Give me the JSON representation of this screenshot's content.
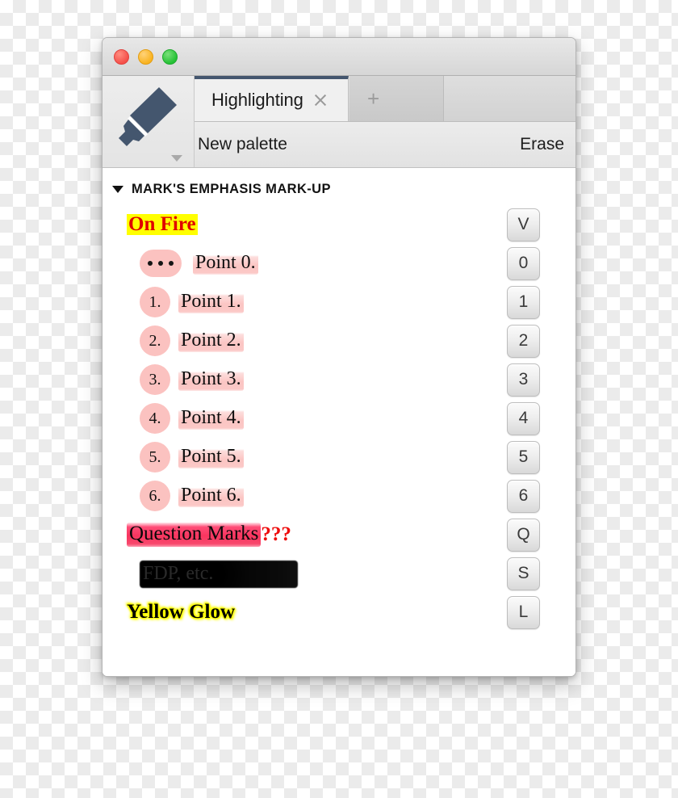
{
  "window": {
    "traffic_lights": [
      "close",
      "minimize",
      "maximize"
    ]
  },
  "tabs": {
    "active": {
      "label": "Highlighting",
      "close_icon": "close-icon"
    },
    "new_tab": {
      "label": "+"
    }
  },
  "tool": {
    "icon": "highlighter-marker-icon",
    "caret": "chevron-down-icon"
  },
  "toolbar": {
    "new_palette_label": "New palette",
    "erase_label": "Erase"
  },
  "section": {
    "disclosure": "disclosure-triangle-open",
    "title": "MARK'S EMPHASIS MARK-UP"
  },
  "colors": {
    "yellow_highlight": "#ffff00",
    "fire_text": "#e00000",
    "pink_highlight": "#fbc2c0",
    "crimson_highlight": "#f8355f",
    "question_mark_red": "#ee0d0d",
    "redact_black": "#000000",
    "tab_accent": "#44566e",
    "marker_body": "#44566e"
  },
  "rows": [
    {
      "style": "onfire",
      "text": "On Fire",
      "key": "V"
    },
    {
      "style": "bullet",
      "text": "Point 0.",
      "key": "0",
      "bullet_dots": 3
    },
    {
      "style": "numbered",
      "text": "Point 1.",
      "key": "1",
      "number": "1."
    },
    {
      "style": "numbered",
      "text": "Point 2.",
      "key": "2",
      "number": "2."
    },
    {
      "style": "numbered",
      "text": "Point 3.",
      "key": "3",
      "number": "3."
    },
    {
      "style": "numbered",
      "text": "Point 4.",
      "key": "4",
      "number": "4."
    },
    {
      "style": "numbered",
      "text": "Point 5.",
      "key": "5",
      "number": "5."
    },
    {
      "style": "numbered",
      "text": "Point 6.",
      "key": "6",
      "number": "6."
    },
    {
      "style": "question",
      "text": "Question Marks",
      "suffix": "???",
      "key": "Q"
    },
    {
      "style": "redacted",
      "text": "FDP, etc.",
      "key": "S"
    },
    {
      "style": "glow",
      "text": "Yellow Glow",
      "key": "L"
    }
  ]
}
